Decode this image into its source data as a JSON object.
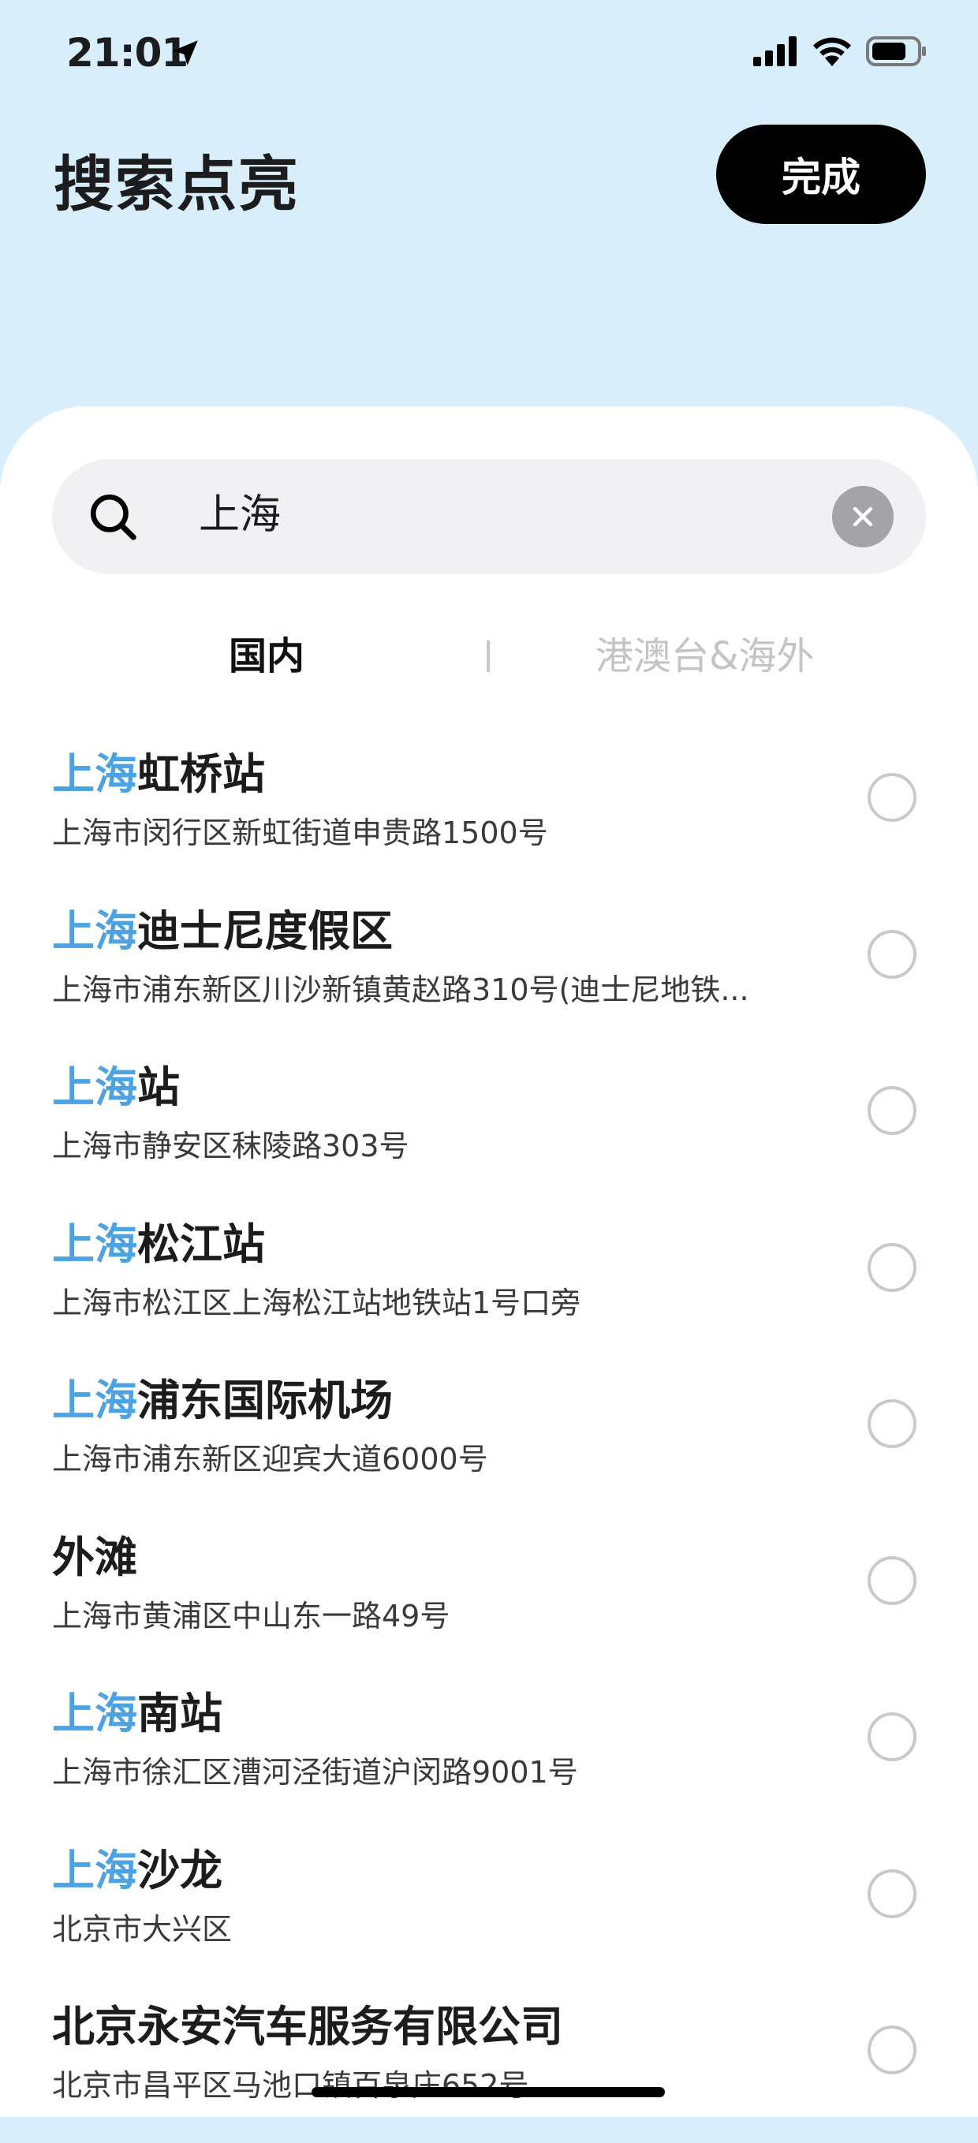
{
  "status_bar": {
    "time": "21:01"
  },
  "header": {
    "title": "搜索点亮",
    "done_label": "完成"
  },
  "search": {
    "value": "上海"
  },
  "tabs": [
    {
      "label": "国内",
      "active": true
    },
    {
      "label": "港澳台&海外",
      "active": false
    }
  ],
  "colors": {
    "accent": "#4da3e2",
    "header_bg": "#d9eefb"
  },
  "results": [
    {
      "highlight": "上海",
      "rest": "虹桥站",
      "address": "上海市闵行区新虹街道申贵路1500号",
      "selected": false
    },
    {
      "highlight": "上海",
      "rest": "迪士尼度假区",
      "address": "上海市浦东新区川沙新镇黄赵路310号(迪士尼地铁...",
      "selected": false
    },
    {
      "highlight": "上海",
      "rest": "站",
      "address": "上海市静安区秣陵路303号",
      "selected": false
    },
    {
      "highlight": "上海",
      "rest": "松江站",
      "address": "上海市松江区上海松江站地铁站1号口旁",
      "selected": false
    },
    {
      "highlight": "上海",
      "rest": "浦东国际机场",
      "address": "上海市浦东新区迎宾大道6000号",
      "selected": false
    },
    {
      "highlight": "",
      "rest": "外滩",
      "address": "上海市黄浦区中山东一路49号",
      "selected": false
    },
    {
      "highlight": "上海",
      "rest": "南站",
      "address": "上海市徐汇区漕河泾街道沪闵路9001号",
      "selected": false
    },
    {
      "highlight": "上海",
      "rest": "沙龙",
      "address": "北京市大兴区",
      "selected": false
    },
    {
      "highlight": "",
      "rest": "北京永安汽车服务有限公司",
      "address": "北京市昌平区马池口镇百泉庄652号",
      "selected": false
    }
  ]
}
